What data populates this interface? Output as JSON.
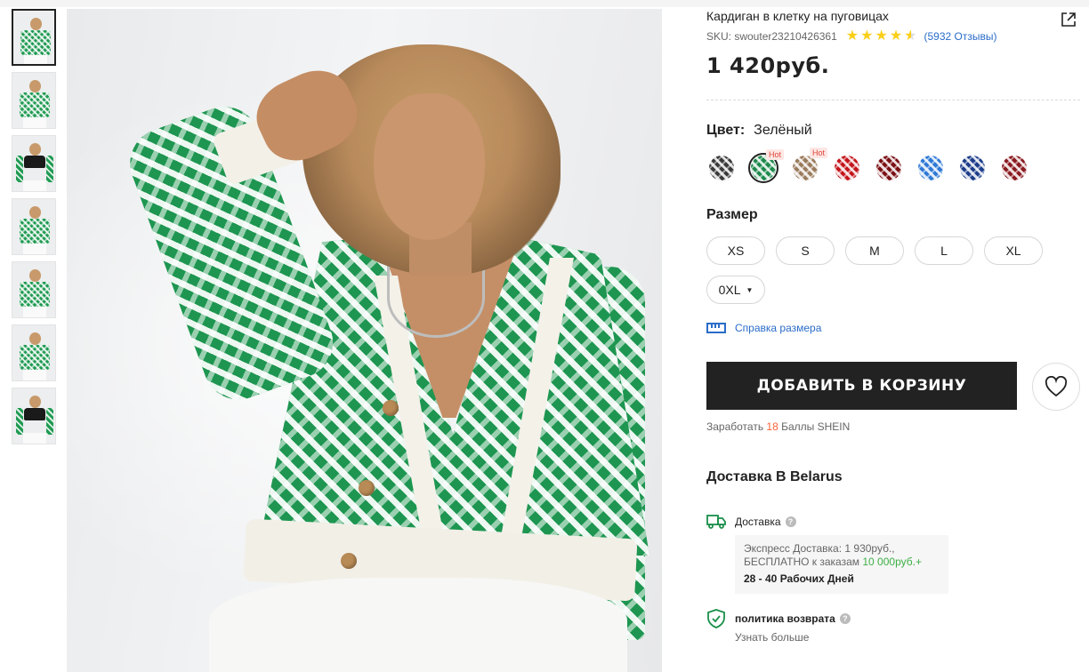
{
  "product": {
    "title": "Кардиган в клетку на пуговицах",
    "sku": "SKU: swouter23210426361",
    "rating": 4.5,
    "reviews": "(5932 Отзывы)",
    "price": "1 420руб."
  },
  "color": {
    "label": "Цвет:",
    "value": "Зелёный",
    "swatches": [
      {
        "color": "#3a3a3a",
        "hot": ""
      },
      {
        "color": "#1e8a4c",
        "hot": "Hot",
        "selected": true
      },
      {
        "color": "#9a7b5c",
        "hot": "Hot"
      },
      {
        "color": "#c4161c",
        "hot": ""
      },
      {
        "color": "#7a1014",
        "hot": ""
      },
      {
        "color": "#2f79d6",
        "hot": ""
      },
      {
        "color": "#1d3d8a",
        "hot": ""
      },
      {
        "color": "#8a1b20",
        "hot": ""
      }
    ]
  },
  "size": {
    "label": "Размер",
    "options": [
      "XS",
      "S",
      "M",
      "L",
      "XL"
    ],
    "select_value": "0XL",
    "guide": "Справка размера"
  },
  "cart": {
    "add_label": "ДОБАВИТЬ В КОРЗИНУ",
    "points_prefix": "Заработать",
    "points_value": "18",
    "points_suffix": "Баллы SHEIN"
  },
  "delivery": {
    "title": "Доставка В Belarus",
    "shipping_label": "Доставка",
    "line1": "Экспресс Доставка: 1 930руб.,",
    "line2_prefix": "БЕСПЛАТНО к заказам",
    "line2_value": "10 000руб.+",
    "days": "28 - 40 Рабочих Дней",
    "return_label": "политика возврата",
    "learn_more": "Узнать больше"
  },
  "icons": {
    "share": "share-icon",
    "heart": "heart-icon",
    "truck": "truck-icon",
    "shield": "shield-icon",
    "ruler": "ruler-icon",
    "help": "question-icon"
  }
}
